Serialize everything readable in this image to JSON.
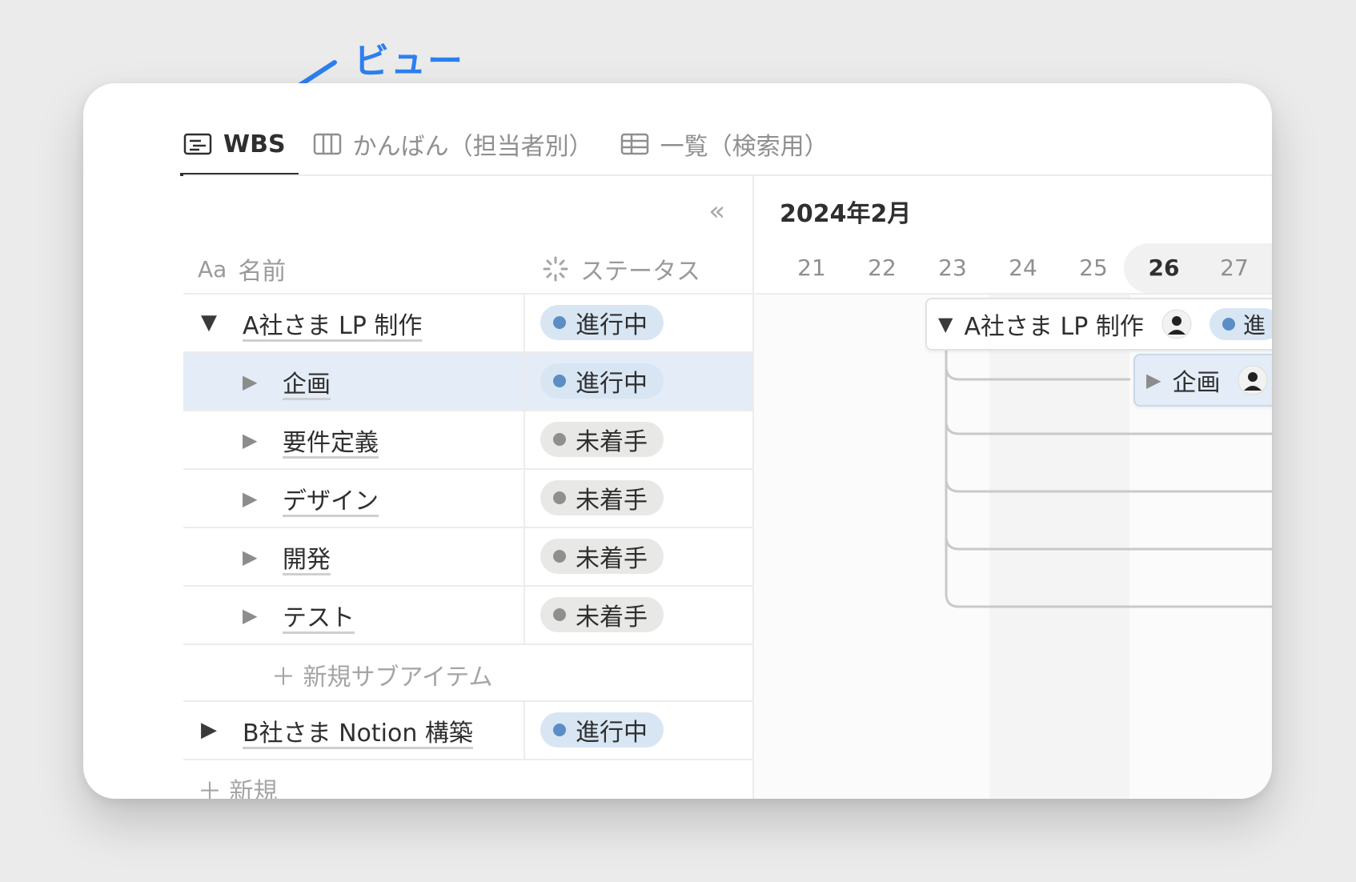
{
  "annotation": {
    "label": "ビュー"
  },
  "tabs": [
    {
      "label": "WBS",
      "icon": "timeline-icon",
      "active": true
    },
    {
      "label": "かんばん（担当者別）",
      "icon": "board-icon",
      "active": false
    },
    {
      "label": "一覧（検索用）",
      "icon": "table-icon",
      "active": false
    }
  ],
  "table": {
    "collapse_icon": "«",
    "columns": {
      "name_prefix": "Aa",
      "name": "名前",
      "status": "ステータス"
    },
    "rows": [
      {
        "toggle": "▼",
        "name": "A社さま LP 制作",
        "status": "進行中",
        "level": 0
      },
      {
        "toggle": "▶",
        "name": "企画",
        "status": "進行中",
        "level": 1,
        "selected": true
      },
      {
        "toggle": "▶",
        "name": "要件定義",
        "status": "未着手",
        "level": 1
      },
      {
        "toggle": "▶",
        "name": "デザイン",
        "status": "未着手",
        "level": 1
      },
      {
        "toggle": "▶",
        "name": "開発",
        "status": "未着手",
        "level": 1
      },
      {
        "toggle": "▶",
        "name": "テスト",
        "status": "未着手",
        "level": 1
      }
    ],
    "new_sub_item": "＋ 新規サブアイテム",
    "row_b": {
      "toggle": "▶",
      "name": "B社さま Notion 構築",
      "status": "進行中"
    },
    "new_item": "＋ 新規"
  },
  "timeline": {
    "month": "2024年2月",
    "days": [
      "21",
      "22",
      "23",
      "24",
      "25",
      "26",
      "27"
    ],
    "today": "26",
    "bars": [
      {
        "toggle": "▼",
        "label": "A社さま LP 制作",
        "status": "進"
      },
      {
        "toggle": "▶",
        "label": "企画"
      }
    ]
  },
  "colors": {
    "accent": "#2d7ff0",
    "in_progress_bg": "#d8e6f4",
    "in_progress_dot": "#5b8ec5",
    "not_started_bg": "#e8e8e6",
    "not_started_dot": "#8f8f8f",
    "selected_row": "#e3ecf7"
  }
}
